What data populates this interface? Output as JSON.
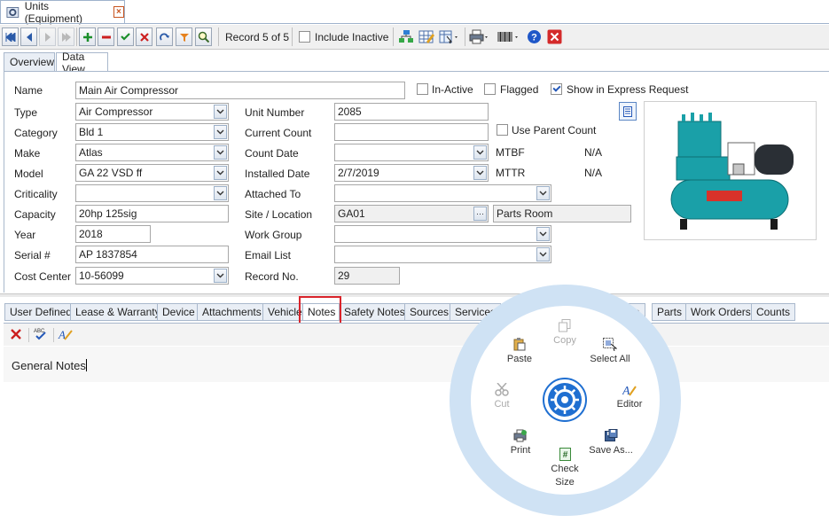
{
  "window": {
    "tab_title": "Units (Equipment)"
  },
  "toolbar": {
    "record_text": "Record 5 of 5",
    "include_inactive_label": "Include Inactive"
  },
  "view_tabs": {
    "overview": "Overview",
    "data_view": "Data View"
  },
  "form": {
    "name_label": "Name",
    "name_value": "Main Air Compressor",
    "inactive_label": "In-Active",
    "flagged_label": "Flagged",
    "express_label": "Show in Express Request",
    "type_label": "Type",
    "type_value": "Air Compressor",
    "category_label": "Category",
    "category_value": "Bld 1",
    "make_label": "Make",
    "make_value": "Atlas",
    "model_label": "Model",
    "model_value": "GA 22 VSD ff",
    "criticality_label": "Criticality",
    "criticality_value": "",
    "capacity_label": "Capacity",
    "capacity_value": "20hp 125sig",
    "year_label": "Year",
    "year_value": "2018",
    "serial_label": "Serial #",
    "serial_value": "AP 1837854",
    "cost_center_label": "Cost Center",
    "cost_center_value": "10-56099",
    "unit_number_label": "Unit Number",
    "unit_number_value": "2085",
    "current_count_label": "Current Count",
    "current_count_value": "",
    "use_parent_label": "Use Parent Count",
    "count_date_label": "Count Date",
    "count_date_value": "",
    "installed_date_label": "Installed Date",
    "installed_date_value": "2/7/2019",
    "attached_label": "Attached To",
    "attached_value": "",
    "site_label": "Site / Location",
    "site_value": "GA01",
    "location_value": "Parts Room",
    "work_group_label": "Work Group",
    "work_group_value": "",
    "email_label": "Email List",
    "email_value": "",
    "record_no_label": "Record No.",
    "record_no_value": "29",
    "mtbf_label": "MTBF",
    "mtbf_value": "N/A",
    "mttr_label": "MTTR",
    "mttr_value": "N/A"
  },
  "sub_tabs": [
    "User Defined",
    "Lease & Warranty",
    "Device",
    "Attachments",
    "Vehicle",
    "Notes",
    "Safety Notes",
    "Sources",
    "Services",
    "ce",
    "Parts",
    "Work Orders",
    "Counts"
  ],
  "notes": {
    "content": "General Notes"
  },
  "radial_menu": {
    "copy": "Copy",
    "paste": "Paste",
    "select_all": "Select All",
    "cut": "Cut",
    "editor": "Editor",
    "print": "Print",
    "save_as": "Save As...",
    "check_size_1": "Check",
    "check_size_2": "Size"
  },
  "colors": {
    "accent": "#2458b8",
    "highlight": "#d9242b",
    "ring": "#cfe2f4",
    "teal": "#1aa0a8"
  }
}
